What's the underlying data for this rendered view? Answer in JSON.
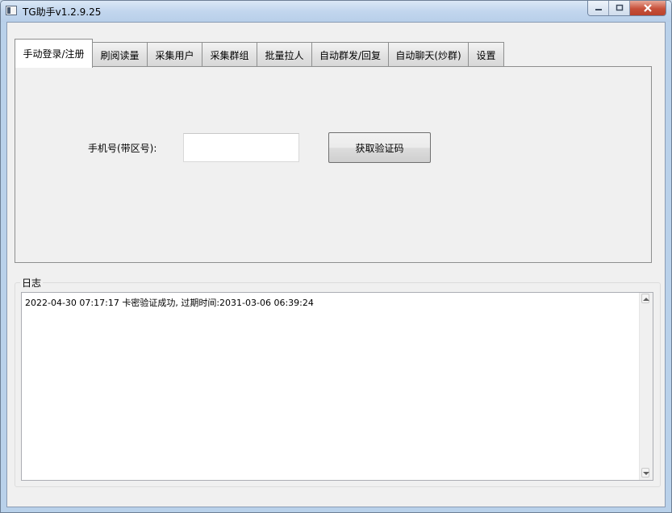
{
  "window": {
    "title": "TG助手v1.2.9.25"
  },
  "tabs": [
    {
      "label": "手动登录/注册",
      "active": true
    },
    {
      "label": "刷阅读量",
      "active": false
    },
    {
      "label": "采集用户",
      "active": false
    },
    {
      "label": "采集群组",
      "active": false
    },
    {
      "label": "批量拉人",
      "active": false
    },
    {
      "label": "自动群发/回复",
      "active": false
    },
    {
      "label": "自动聊天(炒群)",
      "active": false
    },
    {
      "label": "设置",
      "active": false
    }
  ],
  "login": {
    "phone_label": "手机号(带区号):",
    "phone_value": "",
    "get_code_label": "获取验证码"
  },
  "log": {
    "legend": "日志",
    "lines": [
      "2022-04-30 07:17:17 卡密验证成功, 过期时间:2031-03-06 06:39:24"
    ]
  },
  "icons": {
    "app": "app-window-icon",
    "minimize": "minimize-icon",
    "maximize": "maximize-icon",
    "close": "close-icon",
    "scroll_up": "arrow-up-icon",
    "scroll_down": "arrow-down-icon"
  },
  "colors": {
    "title_bar": "#c2d6ee",
    "client_bg": "#f0f0f0",
    "close_button": "#c7503a"
  }
}
